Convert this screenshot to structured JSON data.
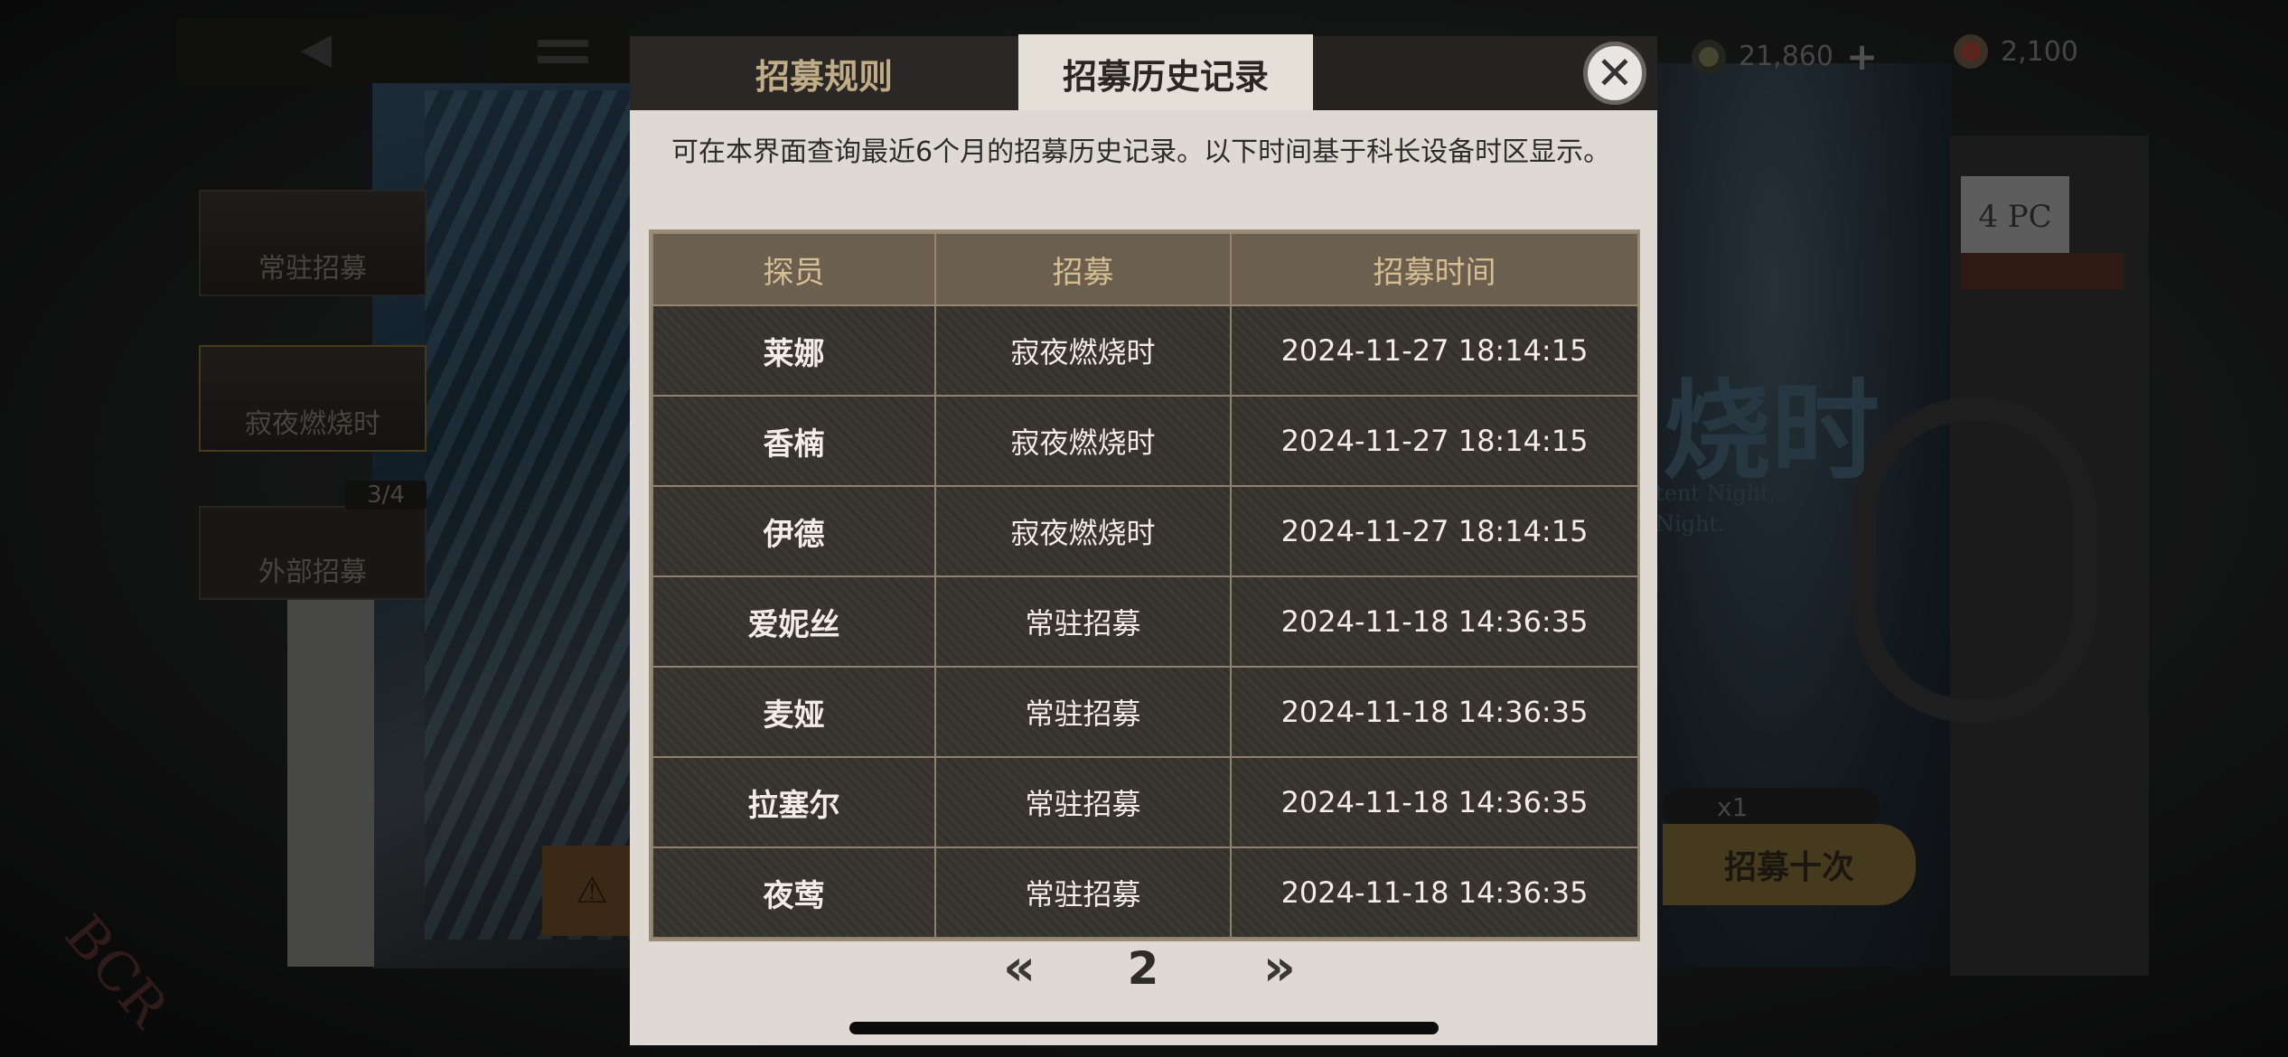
{
  "background": {
    "currency": [
      {
        "icon": "coin-icon",
        "amount": "21,860",
        "add": "+"
      },
      {
        "icon": "gem-icon",
        "amount": "2,100"
      }
    ],
    "banners": [
      {
        "label": "常驻招募"
      },
      {
        "label": "寂夜燃烧时"
      },
      {
        "label": "外部招募",
        "badge": "3/4"
      }
    ],
    "logo_text": "BCR",
    "banner_title": "烧时",
    "banner_sub1": "tent Night,",
    "banner_sub2": "Night.",
    "pull_cost": "x1",
    "pull_ten_label": "招募十次",
    "card_tag": "4 PC"
  },
  "tabs": [
    {
      "label": "招募规则",
      "active": false
    },
    {
      "label": "招募历史记录",
      "active": true
    }
  ],
  "close_symbol": "✕",
  "description": "可在本界面查询最近6个月的招募历史记录。以下时间基于科长设备时区显示。",
  "table": {
    "headers": [
      "探员",
      "招募",
      "招募时间"
    ],
    "rows": [
      {
        "agent": "莱娜",
        "pool": "寂夜燃烧时",
        "time": "2024-11-27 18:14:15"
      },
      {
        "agent": "香楠",
        "pool": "寂夜燃烧时",
        "time": "2024-11-27 18:14:15"
      },
      {
        "agent": "伊德",
        "pool": "寂夜燃烧时",
        "time": "2024-11-27 18:14:15"
      },
      {
        "agent": "爱妮丝",
        "pool": "常驻招募",
        "time": "2024-11-18 14:36:35"
      },
      {
        "agent": "麦娅",
        "pool": "常驻招募",
        "time": "2024-11-18 14:36:35"
      },
      {
        "agent": "拉塞尔",
        "pool": "常驻招募",
        "time": "2024-11-18 14:36:35"
      },
      {
        "agent": "夜莺",
        "pool": "常驻招募",
        "time": "2024-11-18 14:36:35"
      }
    ]
  },
  "pagination": {
    "prev": "«",
    "page": "2",
    "next": "»"
  },
  "colors": {
    "accent_gold": "#d6be92",
    "table_bg": "#37332d",
    "modal_bg": "#dedad3"
  }
}
